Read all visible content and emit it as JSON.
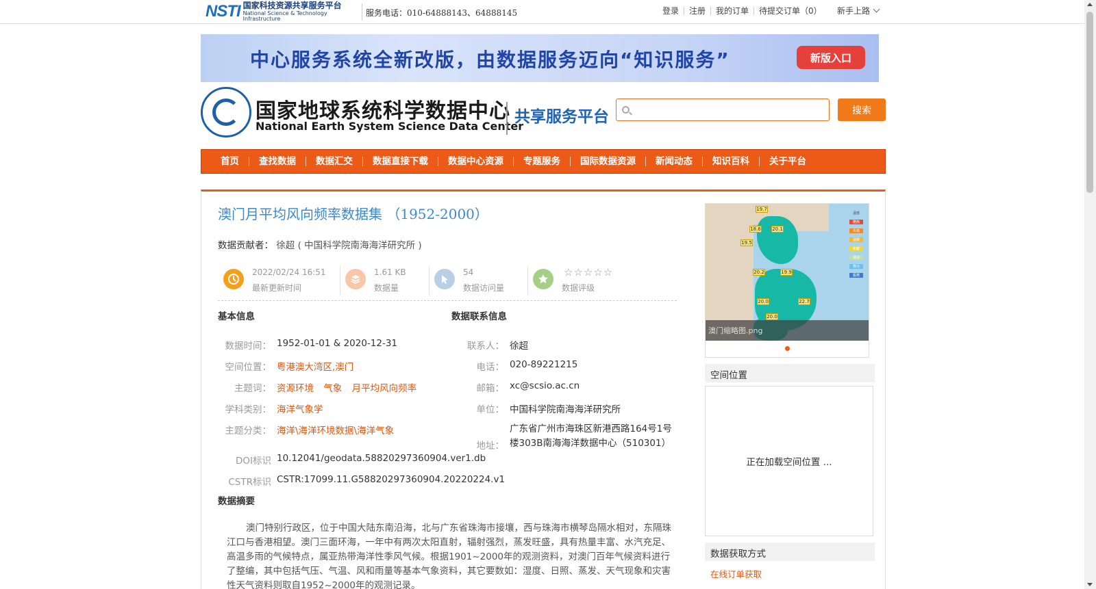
{
  "topbar": {
    "logo_mark": "NSTI",
    "logo_cn": "国家科技资源共享服务平台",
    "logo_en": "National Science & Technology Infrastructure",
    "phone": "服务电话：010-64888143、64888145",
    "links": [
      "登录",
      "注册",
      "我的订单",
      "待提交订单（0）"
    ],
    "guide": "新手上路"
  },
  "banner": {
    "text": "中心服务系统全新改版，由数据服务迈向“知识服务”",
    "button": "新版入口"
  },
  "header": {
    "center_cn": "国家地球系统科学数据中心",
    "center_en": "National Earth System Science Data Center",
    "platform": "共享服务平台",
    "search_placeholder": "",
    "search_button": "搜索"
  },
  "nav": [
    "首页",
    "查找数据",
    "数据汇交",
    "数据直接下载",
    "数据中心资源",
    "专题服务",
    "国际数据资源",
    "新闻动态",
    "知识百科",
    "关于平台"
  ],
  "dataset": {
    "title": "澳门月平均风向频率数据集 （1952-2000）",
    "contributor_label": "数据贡献者：",
    "contributor": "徐超 ( 中国科学院南海海洋研究所 )",
    "stats": [
      {
        "value": "2022/02/24 16:51",
        "label": "最新更新时间",
        "color": "#f5a01a",
        "icon": "clock-icon"
      },
      {
        "value": "1.61 KB",
        "label": "数据量",
        "color": "#f7c7a7",
        "icon": "layers-icon"
      },
      {
        "value": "54",
        "label": "数据访问量",
        "color": "#b9cfe6",
        "icon": "cursor-icon"
      },
      {
        "value": "",
        "label": "数据评级",
        "color": "#a6cf86",
        "icon": "star-icon",
        "stars": "☆☆☆☆☆"
      }
    ]
  },
  "basic": {
    "heading": "基本信息",
    "rows": [
      {
        "label": "数据时间：",
        "value": "1952-01-01 & 2020-12-31"
      },
      {
        "label": "空间位置：",
        "value": "粤港澳大湾区,澳门"
      },
      {
        "label": "主题词：",
        "keywords": [
          "资源环境",
          "气象",
          "月平均风向频率"
        ]
      },
      {
        "label": "学科类别：",
        "value": "海洋气象学"
      },
      {
        "label": "主题分类：",
        "value": "海洋\\海洋环境数据\\海洋气象"
      },
      {
        "label": "DOI标识",
        "value": "10.12041/geodata.58820297360904.ver1.db"
      },
      {
        "label": "CSTR标识",
        "value": "CSTR:17099.11.G58820297360904.20220224.v1"
      }
    ]
  },
  "contact": {
    "heading": "数据联系信息",
    "rows": [
      {
        "label": "联系人：",
        "value": "徐超"
      },
      {
        "label": "电话：",
        "value": "020-89221215"
      },
      {
        "label": "邮箱：",
        "value": "xc@scsio.ac.cn"
      },
      {
        "label": "单位：",
        "value": "中国科学院南海海洋研究所"
      },
      {
        "label": "地址：",
        "value": "广东省广州市海珠区新港西路164号1号楼303B南海海洋数据中心（510301）"
      }
    ]
  },
  "abstract": {
    "heading": "数据摘要",
    "text": "澳门特别行政区，位于中国大陆东南沿海，北与广东省珠海市接壤，西与珠海市横琴岛隔水相对，东隔珠江口与香港相望。澳门三面环海，一年中有两次太阳直射，辐射强烈，蒸发旺盛，具有热量丰富、水汽充足、高温多雨的气候特点，属亚热带海洋性季风气候。根据1901~2000年的观测资料，对澳门百年气候资料进行了整编，其中包括气压、气温、风和雨量等基本气象资料，其它要数如：湿度、日照、蒸发、天气现象和灾害性天气资料则取自1952~2000年的观测记录。"
  },
  "sidebar": {
    "thumb_caption": "澳门缩略图.png",
    "map_pins": [
      "19.7",
      "18.6",
      "20.1",
      "19.5",
      "20.2",
      "19.9",
      "20.0",
      "22.7",
      "20.0"
    ],
    "map_legend": [
      "温度",
      "酷热",
      "炎热",
      "温暖",
      "和暖",
      "清凉",
      "寒冷",
      "极寒"
    ],
    "spatial_heading": "空间位置",
    "spatial_loading": "正在加载空间位置 ...",
    "access_heading": "数据获取方式",
    "access_link": "在线订单获取"
  }
}
